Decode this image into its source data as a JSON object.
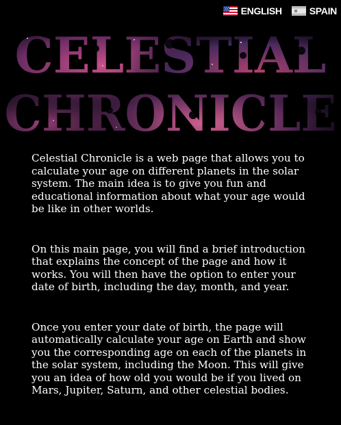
{
  "header": {
    "languages": [
      {
        "label": "ENGLISH",
        "flag": "us-flag-icon"
      },
      {
        "label": "SPAIN",
        "flag": "spain-flag-icon"
      }
    ]
  },
  "hero": {
    "title_line1": "CELESTIAL",
    "title_line2": "CHRONICLE"
  },
  "intro": {
    "paragraphs": [
      "Celestial Chronicle is a web page that allows you to calculate your age on different planets in the solar system. The main idea is to give you fun and educational information about what your age would be like in other worlds.",
      "On this main page, you will find a brief introduction that explains the concept of the page and how it works. You will then have the option to enter your date of birth, including the day, month, and year.",
      "Once you enter your date of birth, the page will automatically calculate your age on Earth and show you the corresponding age on each of the planets in the solar system, including the Moon. This will give you an idea of how old you would be if you lived on Mars, Jupiter, Saturn, and other celestial bodies."
    ]
  },
  "colors": {
    "background": "#000000",
    "text": "#ffffff",
    "nebula_pink": "#b0406f",
    "nebula_purple": "#4a2a5e",
    "space_dark": "#140c1c"
  }
}
